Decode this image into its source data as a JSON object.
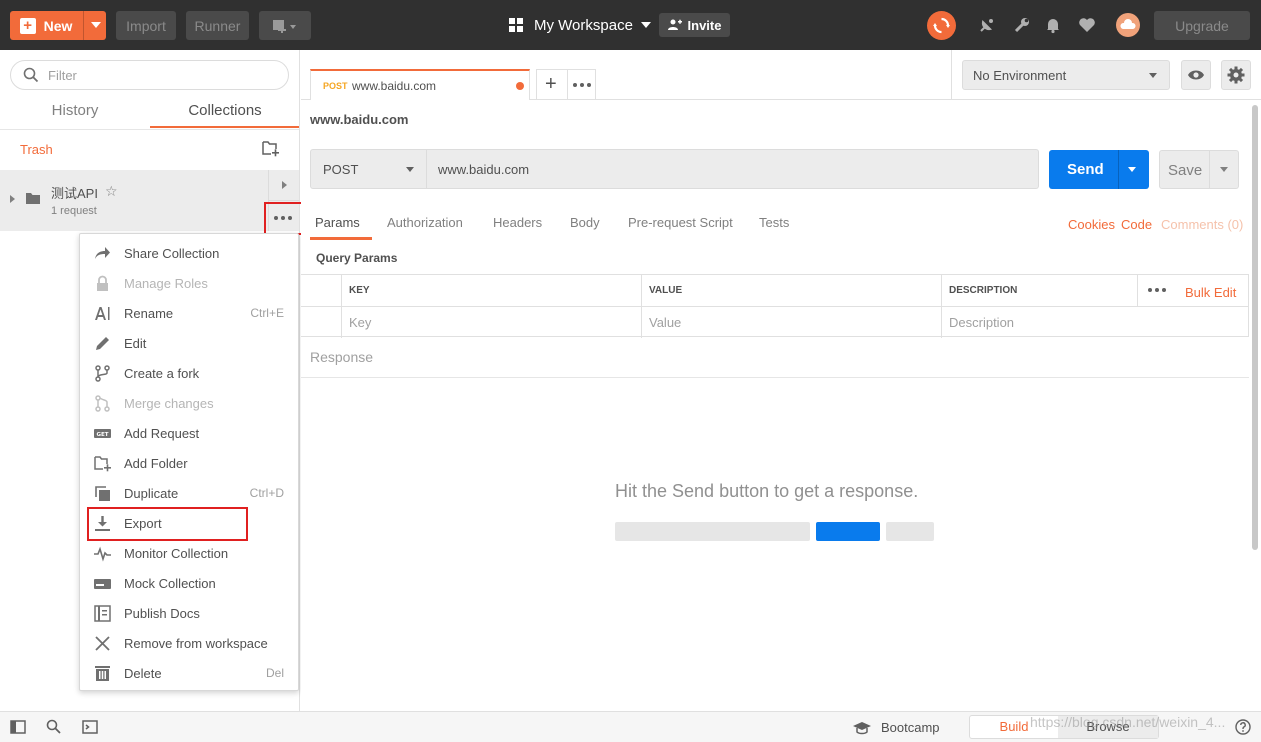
{
  "topbar": {
    "new_label": "New",
    "import_label": "Import",
    "runner_label": "Runner",
    "workspace_label": "My Workspace",
    "invite_label": "Invite",
    "upgrade_label": "Upgrade",
    "accent_color": "#f26b3a"
  },
  "sidebar": {
    "filter_placeholder": "Filter",
    "tabs": [
      "History",
      "Collections"
    ],
    "active_tab": "Collections",
    "trash_label": "Trash",
    "collection": {
      "name": "测试API",
      "count": "1 request"
    }
  },
  "menu": {
    "items": [
      {
        "label": "Share Collection",
        "shortcut": "",
        "icon": "share-arrow-icon",
        "disabled": false
      },
      {
        "label": "Manage Roles",
        "shortcut": "",
        "icon": "lock-icon",
        "disabled": true
      },
      {
        "label": "Rename",
        "shortcut": "Ctrl+E",
        "icon": "rename-icon",
        "disabled": false
      },
      {
        "label": "Edit",
        "shortcut": "",
        "icon": "pencil-icon",
        "disabled": false
      },
      {
        "label": "Create a fork",
        "shortcut": "",
        "icon": "fork-icon",
        "disabled": false
      },
      {
        "label": "Merge changes",
        "shortcut": "",
        "icon": "merge-icon",
        "disabled": true
      },
      {
        "label": "Add Request",
        "shortcut": "",
        "icon": "get-request-icon",
        "disabled": false
      },
      {
        "label": "Add Folder",
        "shortcut": "",
        "icon": "add-folder-icon",
        "disabled": false
      },
      {
        "label": "Duplicate",
        "shortcut": "Ctrl+D",
        "icon": "duplicate-icon",
        "disabled": false
      },
      {
        "label": "Export",
        "shortcut": "",
        "icon": "download-icon",
        "disabled": false
      },
      {
        "label": "Monitor Collection",
        "shortcut": "",
        "icon": "pulse-icon",
        "disabled": false
      },
      {
        "label": "Mock Collection",
        "shortcut": "",
        "icon": "server-icon",
        "disabled": false
      },
      {
        "label": "Publish Docs",
        "shortcut": "",
        "icon": "docs-icon",
        "disabled": false
      },
      {
        "label": "Remove from workspace",
        "shortcut": "",
        "icon": "close-icon",
        "disabled": false
      },
      {
        "label": "Delete",
        "shortcut": "Del",
        "icon": "trash-icon",
        "disabled": false
      }
    ],
    "get_badge": "GET"
  },
  "request_tab": {
    "method": "POST",
    "url": "www.baidu.com"
  },
  "environment": {
    "selected": "No Environment"
  },
  "request": {
    "title": "www.baidu.com",
    "method": "POST",
    "url": "www.baidu.com",
    "send_label": "Send",
    "save_label": "Save",
    "tabs": [
      "Params",
      "Authorization",
      "Headers",
      "Body",
      "Pre-request Script",
      "Tests"
    ],
    "active_tab": "Params",
    "cookies_label": "Cookies",
    "code_label": "Code",
    "comments_label": "Comments (0)"
  },
  "params": {
    "section_title": "Query Params",
    "headers": [
      "KEY",
      "VALUE",
      "DESCRIPTION"
    ],
    "placeholders": [
      "Key",
      "Value",
      "Description"
    ],
    "bulk_edit_label": "Bulk Edit"
  },
  "response": {
    "title": "Response",
    "hint": "Hit the Send button to get a response."
  },
  "footer": {
    "bootcamp_label": "Bootcamp",
    "build_label": "Build",
    "browse_label": "Browse",
    "watermark": "https://blog.csdn.net/weixin_4..."
  }
}
